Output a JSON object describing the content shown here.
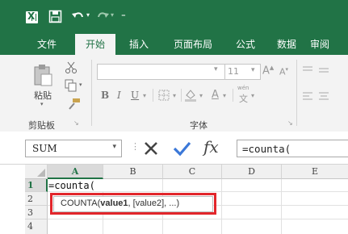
{
  "tabs": [
    {
      "label": "文件"
    },
    {
      "label": "开始"
    },
    {
      "label": "插入"
    },
    {
      "label": "页面布局"
    },
    {
      "label": "公式"
    },
    {
      "label": "数据"
    },
    {
      "label": "审阅"
    }
  ],
  "ribbon": {
    "paste_label": "粘贴",
    "clipboard_group": "剪贴板",
    "font_group": "字体",
    "font_size": "11",
    "phonetic_label": "wén"
  },
  "formula_bar": {
    "name_box": "SUM",
    "fx_label": "fx",
    "formula": "=counta("
  },
  "grid": {
    "columns": [
      "A",
      "B",
      "C",
      "D",
      "E"
    ],
    "rows": [
      "1",
      "2",
      "3",
      "4"
    ],
    "cell_a1": "=counta("
  },
  "tooltip": {
    "func": "COUNTA(",
    "arg1": "value1",
    "rest": ", [value2], ...)"
  },
  "colors": {
    "accent": "#217346",
    "highlight": "#e2262b"
  }
}
